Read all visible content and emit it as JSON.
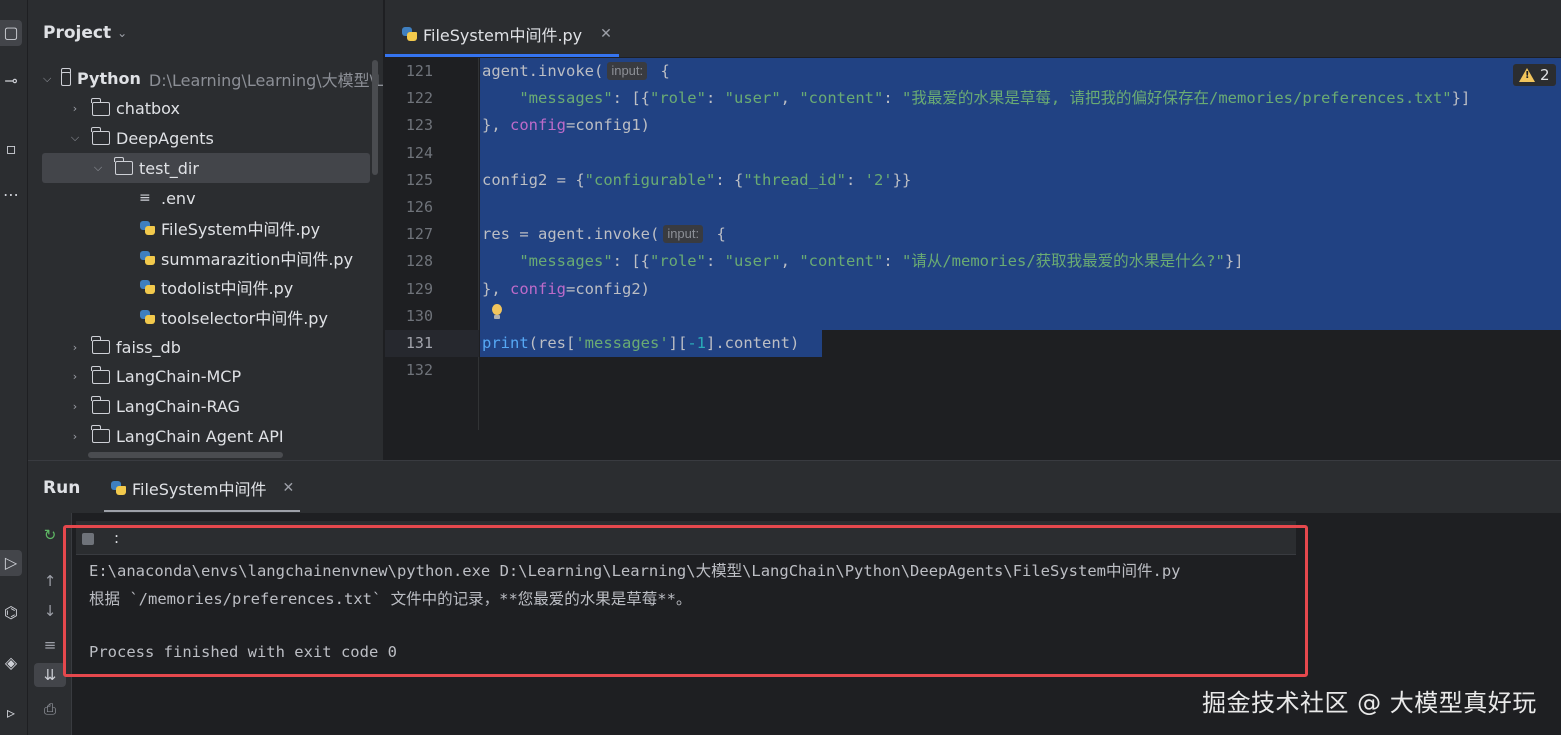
{
  "activity_bar": {
    "icons": [
      "project-icon",
      "commit-icon",
      "structure-icon",
      "more-icon",
      "run-icon",
      "python-packages-icon",
      "layers-icon",
      "terminal-icon"
    ]
  },
  "project": {
    "title": "Project",
    "tree": [
      {
        "label": "Python",
        "path": "D:\\Learning\\Learning\\大模型\\L",
        "type": "folder",
        "expanded": true,
        "depth": 0
      },
      {
        "label": "chatbox",
        "type": "folder",
        "expanded": false,
        "depth": 1
      },
      {
        "label": "DeepAgents",
        "type": "folder",
        "expanded": true,
        "depth": 1
      },
      {
        "label": "test_dir",
        "type": "folder",
        "expanded": true,
        "depth": 2,
        "selected": true
      },
      {
        "label": ".env",
        "type": "env",
        "depth": 3
      },
      {
        "label": "FileSystem中间件.py",
        "type": "py",
        "depth": 3
      },
      {
        "label": "summarazition中间件.py",
        "type": "py",
        "depth": 3
      },
      {
        "label": "todolist中间件.py",
        "type": "py",
        "depth": 3
      },
      {
        "label": "toolselector中间件.py",
        "type": "py",
        "depth": 3
      },
      {
        "label": "faiss_db",
        "type": "folder",
        "expanded": false,
        "depth": 1
      },
      {
        "label": "LangChain-MCP",
        "type": "folder",
        "expanded": false,
        "depth": 1
      },
      {
        "label": "LangChain-RAG",
        "type": "folder",
        "expanded": false,
        "depth": 1
      },
      {
        "label": "LangChain Agent API",
        "type": "folder",
        "expanded": false,
        "depth": 1
      }
    ]
  },
  "editor": {
    "tab_label": "FileSystem中间件.py",
    "warnings_count": "2",
    "line_numbers": [
      "121",
      "122",
      "123",
      "124",
      "125",
      "126",
      "127",
      "128",
      "129",
      "130",
      "131",
      "132"
    ],
    "inlay_hint": "input:",
    "lines": {
      "l121_a": "agent.invoke(",
      "l121_b": " {",
      "l122_a": "    ",
      "l122_s1": "\"messages\"",
      "l122_b": ": [{",
      "l122_s2": "\"role\"",
      "l122_c": ": ",
      "l122_s3": "\"user\"",
      "l122_d": ", ",
      "l122_s4": "\"content\"",
      "l122_e": ": ",
      "l122_s5": "\"我最爱的水果是草莓, 请把我的偏好保存在/memories/preferences.txt\"",
      "l122_f": "}]",
      "l123_a": "}, ",
      "l123_kw": "config",
      "l123_b": "=config1)",
      "l125_a": "config2 = {",
      "l125_s1": "\"configurable\"",
      "l125_b": ": {",
      "l125_s2": "\"thread_id\"",
      "l125_c": ": ",
      "l125_s3": "'2'",
      "l125_d": "}}",
      "l127_a": "res = agent.invoke(",
      "l127_b": " {",
      "l128_a": "    ",
      "l128_s1": "\"messages\"",
      "l128_b": ": [{",
      "l128_s2": "\"role\"",
      "l128_c": ": ",
      "l128_s3": "\"user\"",
      "l128_d": ", ",
      "l128_s4": "\"content\"",
      "l128_e": ": ",
      "l128_s5": "\"请从/memories/获取我最爱的水果是什么?\"",
      "l128_f": "}]",
      "l129_a": "}, ",
      "l129_kw": "config",
      "l129_b": "=config2)",
      "l131_fn": "print",
      "l131_a": "(res[",
      "l131_s1": "'messages'",
      "l131_b": "][",
      "l131_n": "-1",
      "l131_c": "].content)"
    }
  },
  "run": {
    "title": "Run",
    "tab_label": "FileSystem中间件",
    "colon": ":",
    "console_lines": [
      "E:\\anaconda\\envs\\langchainenvnew\\python.exe D:\\Learning\\Learning\\大模型\\LangChain\\Python\\DeepAgents\\FileSystem中间件.py",
      "根据 `/memories/preferences.txt` 文件中的记录，**您最爱的水果是草莓**。",
      "",
      "Process finished with exit code 0"
    ]
  },
  "watermark": "掘金技术社区 @ 大模型真好玩",
  "colors": {
    "selection": "#214283",
    "accent": "#3574f0",
    "highlight_box": "#e5484d",
    "string": "#6aab73",
    "keyword": "#bd6bc9"
  }
}
